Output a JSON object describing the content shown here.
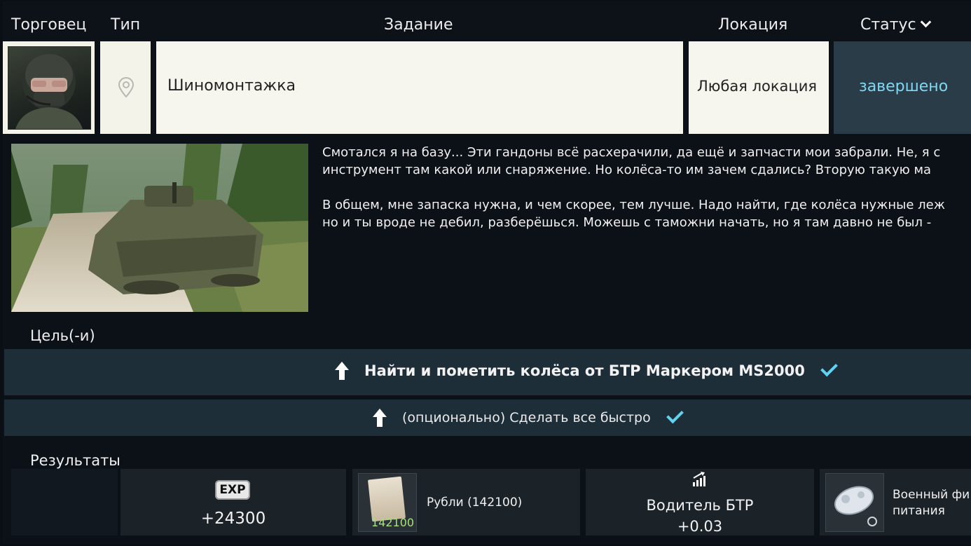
{
  "header": {
    "trader": "Торговец",
    "type": "Тип",
    "task": "Задание",
    "location": "Локация",
    "status": "Статус"
  },
  "quest": {
    "name": "Шиномонтажка",
    "location": "Любая локация",
    "status": "завершено",
    "status_color": "#7fd8f2",
    "type_icon": "map-pin-icon"
  },
  "description": {
    "line1": "Смотался я на базу... Эти гандоны всё расхерачили, да ещё и запчасти мои забрали. Не, я с",
    "line2": "инструмент там какой или снаряжение. Но колёса-то им зачем сдались? Вторую такую ма",
    "line3": "В общем, мне запаска нужна, и чем скорее, тем лучше. Надо найти, где колёса нужные леж",
    "line4": "но и ты вроде не дебил, разберёшься. Можешь с таможни начать, но я там давно не был -"
  },
  "goals": {
    "title": "Цель(-и)",
    "items": [
      {
        "text": "Найти и пометить колёса от БТР Маркером MS2000",
        "done": true
      },
      {
        "text": "(опционально) Сделать все быстро",
        "done": true
      }
    ]
  },
  "results": {
    "title": "Результаты",
    "exp_badge": "EXP",
    "exp_value": "+24300",
    "rubles_label": "Рубли (142100)",
    "rubles_count": "142100",
    "skill_name": "Водитель БТР",
    "skill_value": "+0.03",
    "item_label_1": "Военный фи",
    "item_label_2": "питания"
  },
  "colors": {
    "check": "#5fd3f0",
    "goal_bg": "#1e2e39",
    "status_bg": "#2a3c48"
  }
}
